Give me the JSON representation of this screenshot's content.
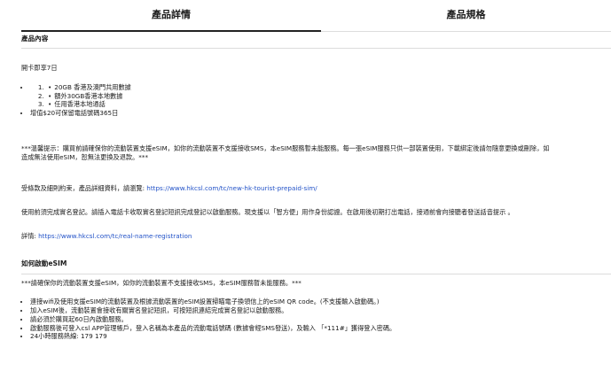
{
  "tabs": {
    "details": "產品詳情",
    "specs": "產品規格"
  },
  "product": {
    "title": "產品內容",
    "activation": "開卡即享7日",
    "items": [
      "20GB 香港及澳門共用數據",
      "額外30GB香港本地數據",
      "任用香港本地通話"
    ],
    "extra": "增值$20可保留電話號碼365日",
    "warning_line1": "***溫馨提示：購買前請確保你的流動裝置支援eSIM，如你的流動裝置不支援接收SMS，本eSIM服務暫未能服務。每一張eSIM服務只供一部裝置使用，下載綁定後請勿隨意更換或刪除，如",
    "warning_line2": "造成無法使用eSIM，恕無法更換及退款。***",
    "terms_prefix": "受條款及細則約束，產品詳細資料，請瀏覽: ",
    "terms_link": "https://www.hkcsl.com/tc/new-hk-tourist-prepaid-sim/",
    "registration": "使用前須完成實名登記。請插入電話卡收取實名登記短訊完成登記以啟動服務。現支援以「智方便」用作身份認證。在啟用後初期打出電話，接通前會向接聽者發送話音提示 。",
    "details_prefix": "詳情: ",
    "details_link": "https://www.hkcsl.com/tc/real-name-registration"
  },
  "esim": {
    "title": "如何啟動eSIM",
    "note": "***請確保你的流動裝置支援eSIM，如你的流動裝置不支援接收SMS，本eSIM服務暫未能服務。***",
    "steps": [
      "連接wifi及使用支援eSIM的流動裝置及根據流動裝置的eSIM設置掃瞄電子換領信上的eSIM QR code。(不支援輸入啟動碼。)",
      "加入eSIM後，流動裝置會接收有關實名登記短訊，可按短訊連結完成實名登記以啟動服務。",
      "請必須於購買起60日內啟動服務。",
      "啟動服務後可登入csl APP管理帳戶，登入名稱為本產品的流動電話號碼 (數據會經SMS發送)，及輸入 「*111#」獲得登入密碼。",
      "24小時服務熱線: 179 179"
    ]
  }
}
